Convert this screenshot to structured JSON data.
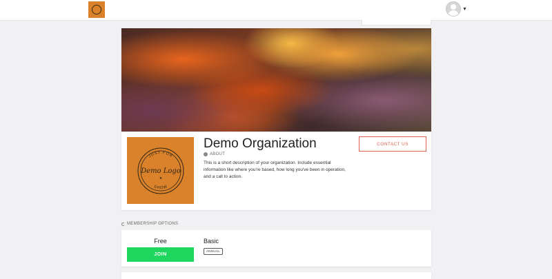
{
  "colors": {
    "page_background": "#f1f1f3",
    "brand_orange": "#d9822b",
    "contact_accent": "#e0604e",
    "join_green": "#1fd65f"
  },
  "header": {
    "logo_icon": "organization-logo-icon",
    "avatar_icon": "user-avatar-icon",
    "menu_caret_icon": "caret-down-icon"
  },
  "organization": {
    "name": "Demo Organization",
    "about_label": "ABOUT",
    "description": "This is a short description of your organization. Include essential information like where you're based, how long you've been in operation, and a call to action.",
    "contact_label": "CONTACT US",
    "logo": {
      "top_text": "JUST FOR",
      "main_text": "Demo Logo",
      "bottom_text": "SHOW"
    }
  },
  "membership": {
    "section_title": "MEMBERSHIP OPTIONS",
    "options": [
      {
        "price": "Free",
        "join_label": "JOIN",
        "plan_name": "Basic",
        "period": "ANNUAL"
      }
    ]
  }
}
